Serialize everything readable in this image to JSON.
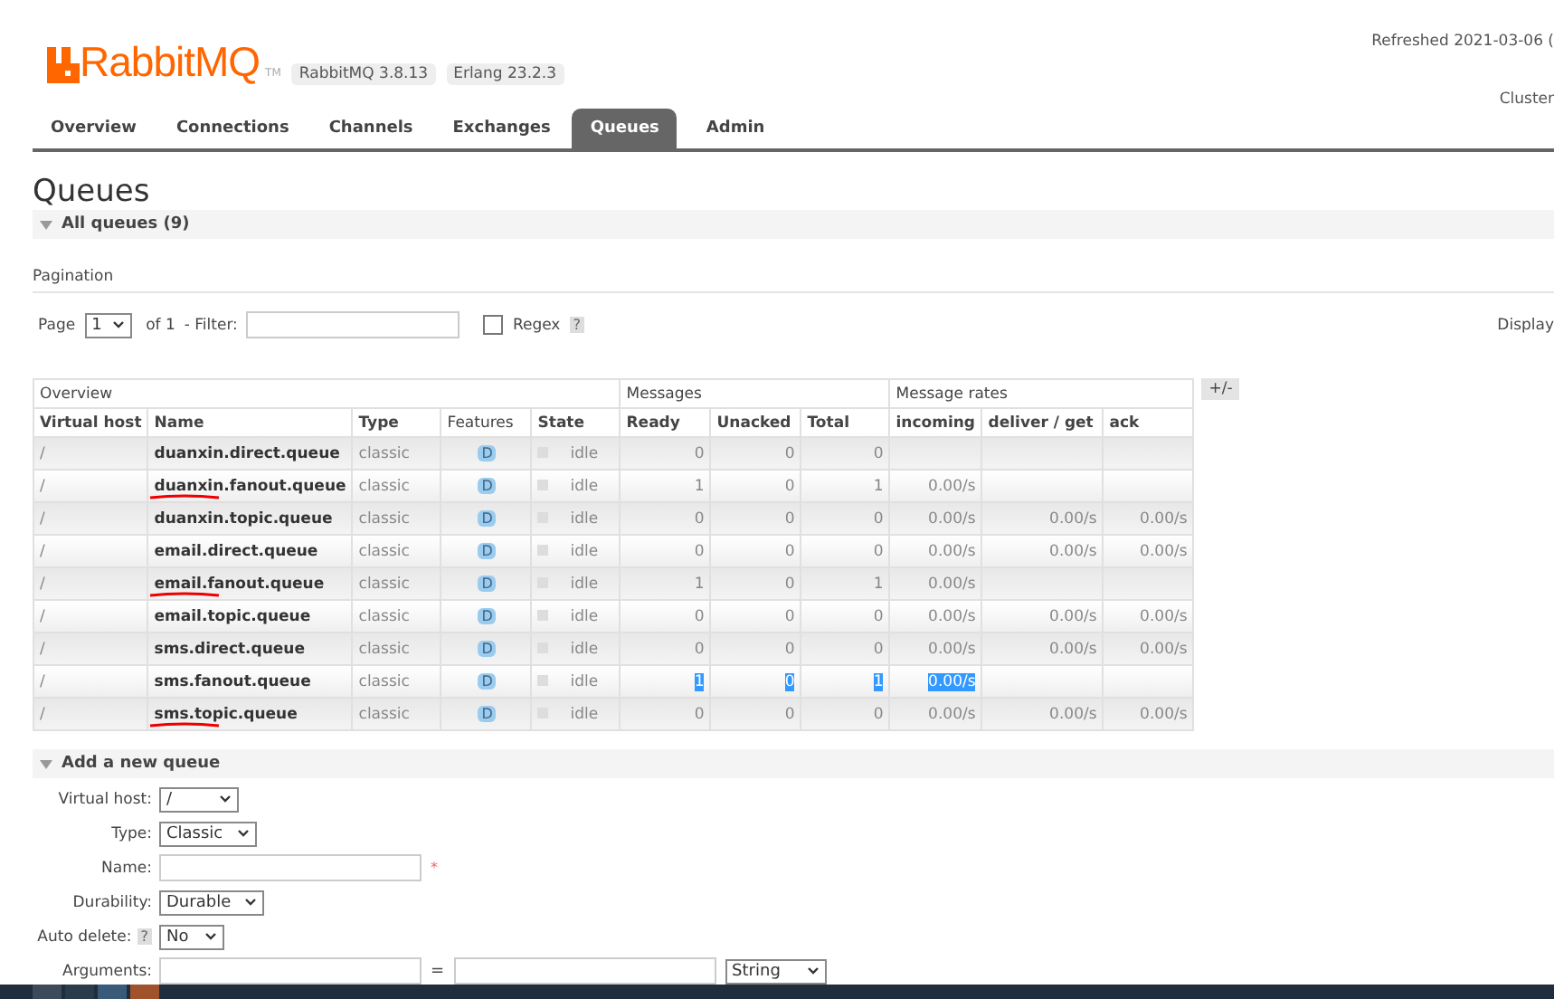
{
  "header": {
    "logo_text": "RabbitMQ",
    "trademark": "TM",
    "version_badges": [
      "RabbitMQ 3.8.13",
      "Erlang 23.2.3"
    ],
    "refreshed": "Refreshed 2021-03-06 (",
    "cluster": "Cluster"
  },
  "tabs": [
    {
      "label": "Overview",
      "selected": false
    },
    {
      "label": "Connections",
      "selected": false
    },
    {
      "label": "Channels",
      "selected": false
    },
    {
      "label": "Exchanges",
      "selected": false
    },
    {
      "label": "Queues",
      "selected": true
    },
    {
      "label": "Admin",
      "selected": false
    }
  ],
  "page_title": "Queues",
  "all_queues": {
    "title": "All queues (9)",
    "expanded": true
  },
  "pagination": {
    "label": "Pagination",
    "page_label": "Page",
    "page": "1",
    "of": "of 1",
    "filter_label": "- Filter:",
    "regex_label": "Regex",
    "regex_checked": false,
    "help": "?",
    "display": "Display"
  },
  "table": {
    "groups": [
      "Overview",
      "Messages",
      "Message rates"
    ],
    "columns": [
      "Virtual host",
      "Name",
      "Type",
      "Features",
      "State",
      "Ready",
      "Unacked",
      "Total",
      "incoming",
      "deliver / get",
      "ack"
    ],
    "toggle": "+/-",
    "rows": [
      {
        "vhost": "/",
        "name": "duanxin.direct.queue",
        "type": "classic",
        "feature": "D",
        "state": "idle",
        "ready": "0",
        "unacked": "0",
        "total": "0",
        "incoming": "",
        "deliver": "",
        "ack": "",
        "marked": false,
        "highlighted": false
      },
      {
        "vhost": "/",
        "name": "duanxin.fanout.queue",
        "type": "classic",
        "feature": "D",
        "state": "idle",
        "ready": "1",
        "unacked": "0",
        "total": "1",
        "incoming": "0.00/s",
        "deliver": "",
        "ack": "",
        "marked": true,
        "highlighted": false
      },
      {
        "vhost": "/",
        "name": "duanxin.topic.queue",
        "type": "classic",
        "feature": "D",
        "state": "idle",
        "ready": "0",
        "unacked": "0",
        "total": "0",
        "incoming": "0.00/s",
        "deliver": "0.00/s",
        "ack": "0.00/s",
        "marked": false,
        "highlighted": false
      },
      {
        "vhost": "/",
        "name": "email.direct.queue",
        "type": "classic",
        "feature": "D",
        "state": "idle",
        "ready": "0",
        "unacked": "0",
        "total": "0",
        "incoming": "0.00/s",
        "deliver": "0.00/s",
        "ack": "0.00/s",
        "marked": false,
        "highlighted": false
      },
      {
        "vhost": "/",
        "name": "email.fanout.queue",
        "type": "classic",
        "feature": "D",
        "state": "idle",
        "ready": "1",
        "unacked": "0",
        "total": "1",
        "incoming": "0.00/s",
        "deliver": "",
        "ack": "",
        "marked": true,
        "highlighted": false
      },
      {
        "vhost": "/",
        "name": "email.topic.queue",
        "type": "classic",
        "feature": "D",
        "state": "idle",
        "ready": "0",
        "unacked": "0",
        "total": "0",
        "incoming": "0.00/s",
        "deliver": "0.00/s",
        "ack": "0.00/s",
        "marked": false,
        "highlighted": false
      },
      {
        "vhost": "/",
        "name": "sms.direct.queue",
        "type": "classic",
        "feature": "D",
        "state": "idle",
        "ready": "0",
        "unacked": "0",
        "total": "0",
        "incoming": "0.00/s",
        "deliver": "0.00/s",
        "ack": "0.00/s",
        "marked": false,
        "highlighted": false
      },
      {
        "vhost": "/",
        "name": "sms.fanout.queue",
        "type": "classic",
        "feature": "D",
        "state": "idle",
        "ready": "1",
        "unacked": "0",
        "total": "1",
        "incoming": "0.00/s",
        "deliver": "",
        "ack": "",
        "marked": false,
        "highlighted": true
      },
      {
        "vhost": "/",
        "name": "sms.topic.queue",
        "type": "classic",
        "feature": "D",
        "state": "idle",
        "ready": "0",
        "unacked": "0",
        "total": "0",
        "incoming": "0.00/s",
        "deliver": "0.00/s",
        "ack": "0.00/s",
        "marked": true,
        "highlighted": false
      }
    ]
  },
  "add_queue": {
    "title": "Add a new queue",
    "expanded": true,
    "fields": [
      {
        "kind": "select",
        "label": "Virtual host:",
        "value": "/"
      },
      {
        "kind": "select",
        "label": "Type:",
        "value": "Classic"
      },
      {
        "kind": "text",
        "label": "Name:",
        "required": "*"
      },
      {
        "kind": "select",
        "label": "Durability:",
        "value": "Durable"
      },
      {
        "kind": "select",
        "label": "Auto delete:",
        "value": "No",
        "help": "?"
      },
      {
        "kind": "arguments",
        "label": "Arguments:",
        "separator": "=",
        "value": "String"
      }
    ]
  }
}
